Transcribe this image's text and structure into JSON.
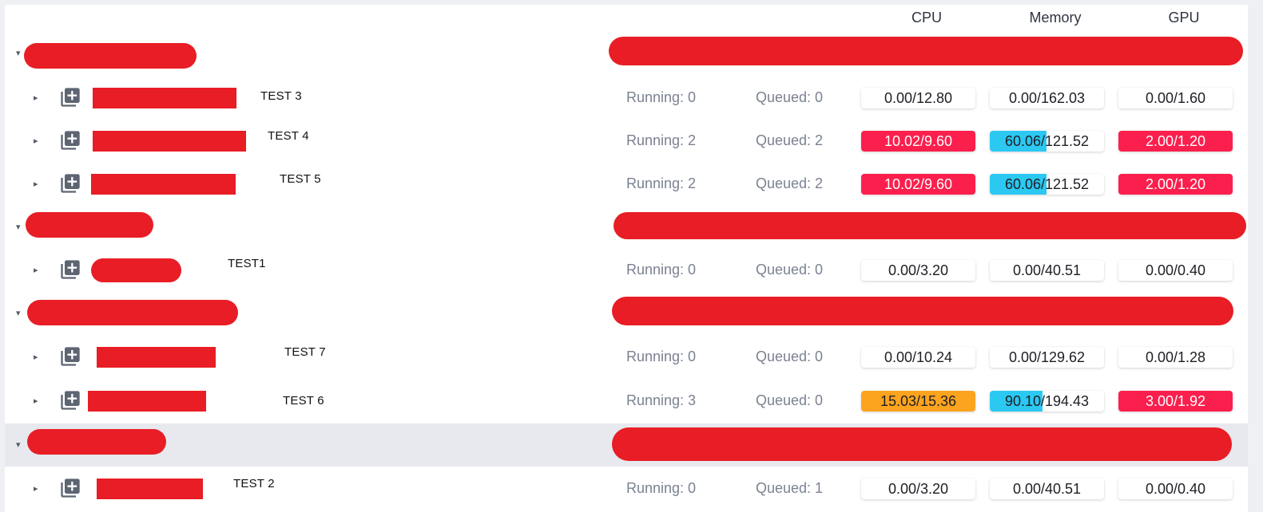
{
  "headers": {
    "cpu": "CPU",
    "memory": "Memory",
    "gpu": "GPU"
  },
  "colors": {
    "over": "#fb1f4d",
    "warn": "#fda41f",
    "mem": "#2bc8f2",
    "redaction": "#e81d25"
  },
  "queues": [
    {
      "name": "TEST 3",
      "running": "Running: 0",
      "queued": "Queued: 0",
      "cpu": {
        "text": "0.00/12.80",
        "fill": 0,
        "state": "normal"
      },
      "mem": {
        "text": "0.00/162.03",
        "fill": 0,
        "state": "normal"
      },
      "gpu": {
        "text": "0.00/1.60",
        "fill": 0,
        "state": "normal"
      }
    },
    {
      "name": "TEST 4",
      "running": "Running: 2",
      "queued": "Queued: 2",
      "cpu": {
        "text": "10.02/9.60",
        "fill": 1,
        "state": "over"
      },
      "mem": {
        "text": "60.06/121.52",
        "fill": 0.494,
        "state": "mem"
      },
      "gpu": {
        "text": "2.00/1.20",
        "fill": 1,
        "state": "over"
      }
    },
    {
      "name": "TEST 5",
      "running": "Running: 2",
      "queued": "Queued: 2",
      "cpu": {
        "text": "10.02/9.60",
        "fill": 1,
        "state": "over"
      },
      "mem": {
        "text": "60.06/121.52",
        "fill": 0.494,
        "state": "mem"
      },
      "gpu": {
        "text": "2.00/1.20",
        "fill": 1,
        "state": "over"
      }
    },
    {
      "name": "TEST1",
      "running": "Running: 0",
      "queued": "Queued: 0",
      "cpu": {
        "text": "0.00/3.20",
        "fill": 0,
        "state": "normal"
      },
      "mem": {
        "text": "0.00/40.51",
        "fill": 0,
        "state": "normal"
      },
      "gpu": {
        "text": "0.00/0.40",
        "fill": 0,
        "state": "normal"
      }
    },
    {
      "name": "TEST 7",
      "running": "Running: 0",
      "queued": "Queued: 0",
      "cpu": {
        "text": "0.00/10.24",
        "fill": 0,
        "state": "normal"
      },
      "mem": {
        "text": "0.00/129.62",
        "fill": 0,
        "state": "normal"
      },
      "gpu": {
        "text": "0.00/1.28",
        "fill": 0,
        "state": "normal"
      }
    },
    {
      "name": "TEST 6",
      "running": "Running: 3",
      "queued": "Queued: 0",
      "cpu": {
        "text": "15.03/15.36",
        "fill": 1,
        "state": "warn"
      },
      "mem": {
        "text": "90.10/194.43",
        "fill": 0.463,
        "state": "mem"
      },
      "gpu": {
        "text": "3.00/1.92",
        "fill": 1,
        "state": "over"
      }
    },
    {
      "name": "TEST 2",
      "running": "Running: 0",
      "queued": "Queued: 1",
      "cpu": {
        "text": "0.00/3.20",
        "fill": 0,
        "state": "normal"
      },
      "mem": {
        "text": "0.00/40.51",
        "fill": 0,
        "state": "normal"
      },
      "gpu": {
        "text": "0.00/0.40",
        "fill": 0,
        "state": "normal"
      }
    }
  ]
}
